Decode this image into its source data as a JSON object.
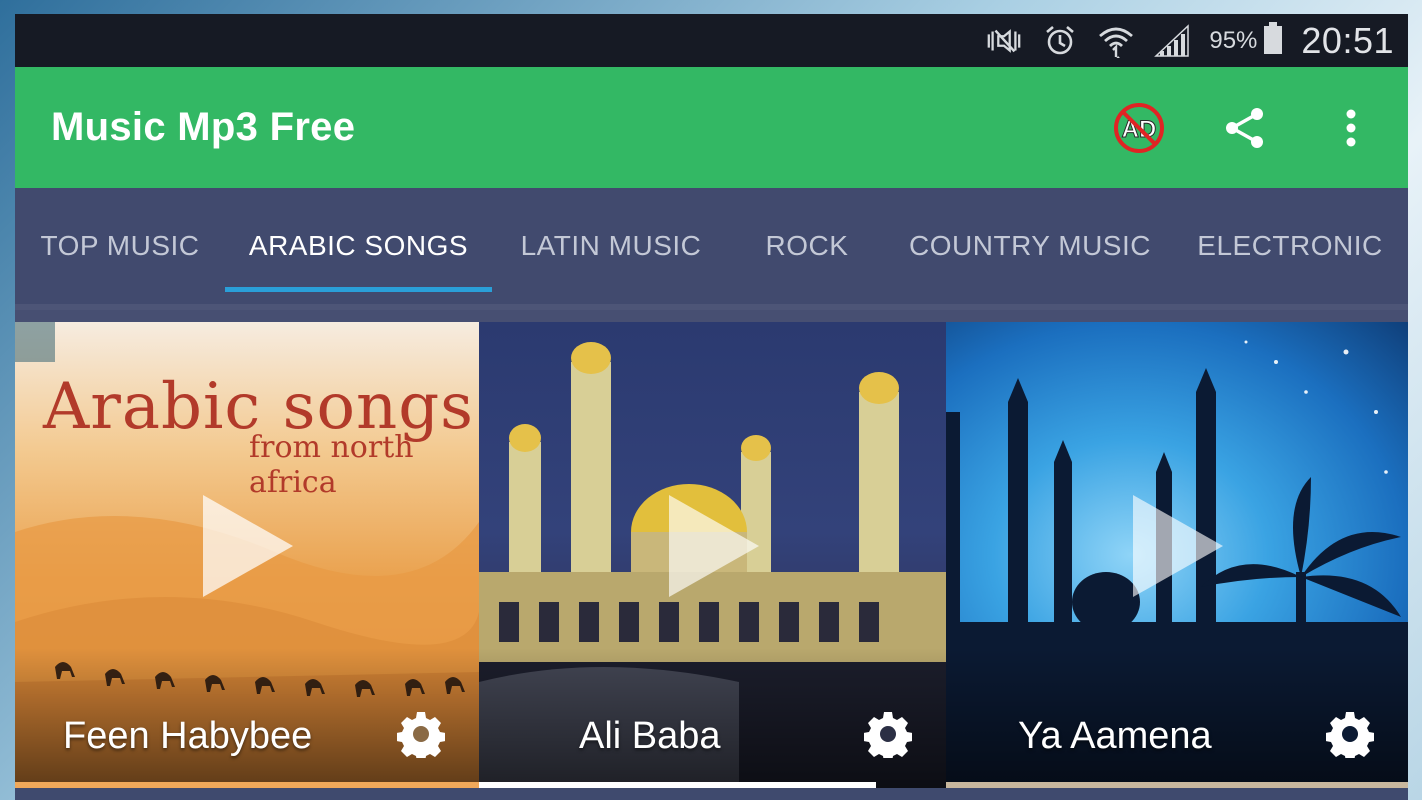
{
  "status_bar": {
    "icons": [
      "mute-vibrate-icon",
      "alarm-icon",
      "wifi-icon",
      "signal-icon",
      "battery-icon"
    ],
    "battery_percent": "95%",
    "time": "20:51"
  },
  "app_bar": {
    "title": "Music Mp3 Free",
    "actions": [
      "no-ads-icon",
      "share-icon",
      "more-vert-icon"
    ],
    "ad_badge_text": "AD",
    "color": "#33b864"
  },
  "tabs": {
    "items": [
      {
        "label": "TOP MUSIC"
      },
      {
        "label": "ARABIC SONGS"
      },
      {
        "label": "LATIN MUSIC"
      },
      {
        "label": "ROCK"
      },
      {
        "label": "COUNTRY MUSIC"
      },
      {
        "label": "ELECTRONIC"
      }
    ],
    "active_index": 1,
    "indicator_color": "#2a9fd8"
  },
  "cards": [
    {
      "name": "Feen Habybee",
      "art_title": "Arabic songs",
      "art_subtitle": "from north africa",
      "underline_color": "#f0a85a"
    },
    {
      "name": "Ali Baba",
      "underline_color": "#ffffff"
    },
    {
      "name": "Ya Aamena",
      "underline_color": "#c8b79d"
    }
  ]
}
